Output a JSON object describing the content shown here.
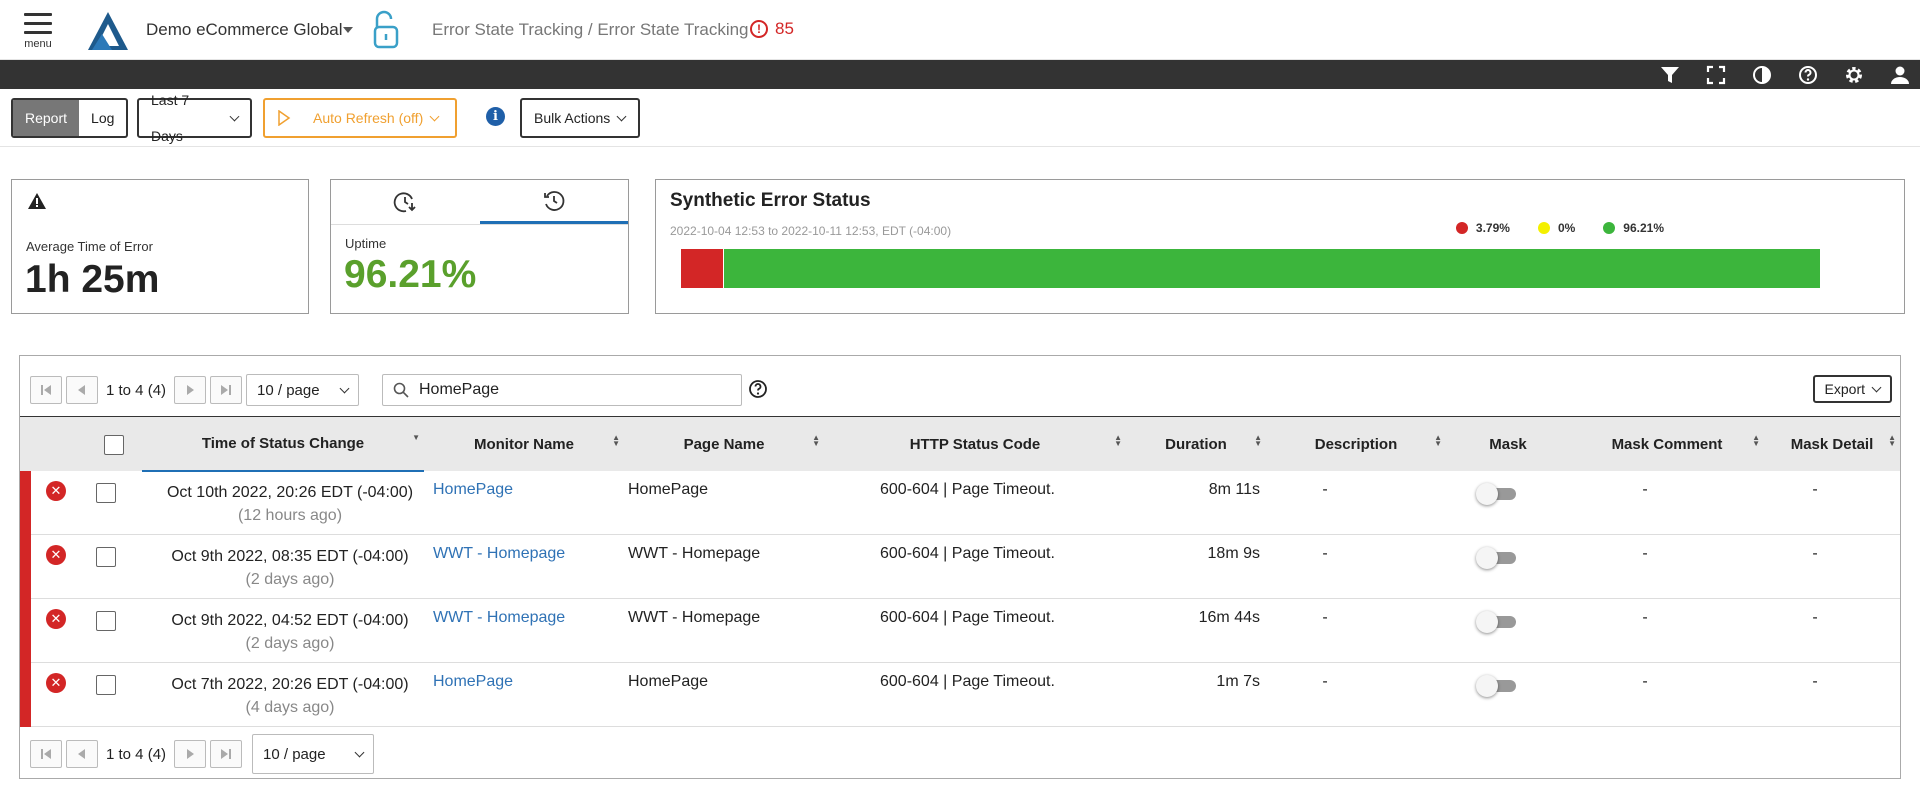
{
  "header": {
    "menu_label": "menu",
    "org_name": "Demo eCommerce Global",
    "breadcrumb": "Error State Tracking / Error State Tracking",
    "error_count": "85",
    "error_icon_glyph": "!"
  },
  "toolbar": {
    "view_report": "Report",
    "view_log": "Log",
    "time_range": "Last 7 Days",
    "auto_refresh": "Auto Refresh (off)",
    "info_glyph": "i",
    "bulk_actions": "Bulk Actions"
  },
  "cards": {
    "avg_error": {
      "label": "Average Time of Error",
      "value": "1h 25m"
    },
    "uptime": {
      "label": "Uptime",
      "value": "96.21%"
    },
    "synthetic": {
      "title": "Synthetic Error Status",
      "range": "2022-10-04 12:53 to 2022-10-11 12:53, EDT (-04:00)",
      "legend": [
        {
          "label": "3.79%",
          "color": "#d32626",
          "fraction": 0.0379
        },
        {
          "label": "0%",
          "color": "#f4f000",
          "fraction": 0
        },
        {
          "label": "96.21%",
          "color": "#3cb53c",
          "fraction": 0.9621
        }
      ]
    }
  },
  "table": {
    "pager": {
      "range": "1 to 4 (4)",
      "per_page": "10 / page"
    },
    "search": {
      "query": "HomePage"
    },
    "export": "Export",
    "columns": [
      "Time of Status Change",
      "Monitor Name",
      "Page Name",
      "HTTP Status Code",
      "Duration",
      "Description",
      "Mask",
      "Mask Comment",
      "Mask Detail"
    ],
    "status_glyph": "✕",
    "rows": [
      {
        "time": "Oct 10th 2022, 20:26 EDT (-04:00)",
        "ago": "(12 hours ago)",
        "monitor": "HomePage",
        "page": "HomePage",
        "http": "600-604 | Page Timeout.",
        "duration": "8m 11s",
        "description": "-",
        "mask_comment": "-",
        "mask_detail": "-"
      },
      {
        "time": "Oct 9th 2022, 08:35 EDT (-04:00)",
        "ago": "(2 days ago)",
        "monitor": "WWT - Homepage",
        "page": "WWT - Homepage",
        "http": "600-604 | Page Timeout.",
        "duration": "18m 9s",
        "description": "-",
        "mask_comment": "-",
        "mask_detail": "-"
      },
      {
        "time": "Oct 9th 2022, 04:52 EDT (-04:00)",
        "ago": "(2 days ago)",
        "monitor": "WWT - Homepage",
        "page": "WWT - Homepage",
        "http": "600-604 | Page Timeout.",
        "duration": "16m 44s",
        "description": "-",
        "mask_comment": "-",
        "mask_detail": "-"
      },
      {
        "time": "Oct 7th 2022, 20:26 EDT (-04:00)",
        "ago": "(4 days ago)",
        "monitor": "HomePage",
        "page": "HomePage",
        "http": "600-604 | Page Timeout.",
        "duration": "1m 7s",
        "description": "-",
        "mask_comment": "-",
        "mask_detail": "-"
      }
    ]
  }
}
